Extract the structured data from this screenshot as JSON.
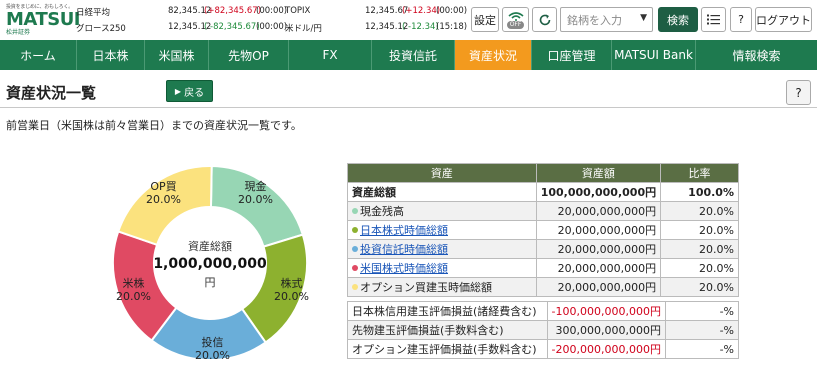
{
  "header": {
    "logo": {
      "tagline": "投資をまじめに、おもしろく。",
      "brand": "MATSUI",
      "sub": "松井証券"
    },
    "markets": [
      {
        "name": "日経平均",
        "value": "82,345.12",
        "change": "(+82,345.67)",
        "time": "(00:00)"
      },
      {
        "name": "グロース250",
        "value": "12,345.12",
        "change": "( -82,345.67)",
        "time": "(00:00)"
      },
      {
        "name": "TOPIX",
        "value": "12,345.67",
        "change": "(+12.34)",
        "time": "(00:00)"
      },
      {
        "name": "米ドル/円",
        "value": "12,345.12",
        "change": "( -12.34)",
        "time": "(15:18)"
      }
    ],
    "settings_label": "設定",
    "toggle_label": "OFF",
    "search_placeholder": "銘柄を入力",
    "search_button": "検索",
    "help": "?",
    "logout": "ログアウト"
  },
  "nav": [
    {
      "label": "ホーム"
    },
    {
      "label": "日本株"
    },
    {
      "label": "米国株"
    },
    {
      "label": "先物OP"
    },
    {
      "label": "FX"
    },
    {
      "label": "投資信託"
    },
    {
      "label": "資産状況"
    },
    {
      "label": "口座管理"
    },
    {
      "label": "MATSUI Bank"
    },
    {
      "label": "情報検索"
    }
  ],
  "page": {
    "title": "資産状況一覧",
    "back": "戻る",
    "help": "?",
    "lead": "前営業日（米国株は前々営業日）までの資産状況一覧です。"
  },
  "donut": {
    "center_label": "資産総額",
    "center_value": "1,000,000,000",
    "center_unit": "円",
    "segments": [
      {
        "name": "現金",
        "pct": "20.0%",
        "value": 20,
        "color": "#97d6b4"
      },
      {
        "name": "株式",
        "pct": "20.0%",
        "value": 20,
        "color": "#8db12f"
      },
      {
        "name": "投信",
        "pct": "20.0%",
        "value": 20,
        "color": "#6aaed9"
      },
      {
        "name": "米株",
        "pct": "20.0%",
        "value": 20,
        "color": "#e04a63"
      },
      {
        "name": "OP買",
        "pct": "20.0%",
        "value": 20,
        "color": "#fbe27e"
      }
    ]
  },
  "table": {
    "headers": [
      "資産",
      "資産額",
      "比率"
    ],
    "rows": [
      {
        "label": "資産総額",
        "amount": "100,000,000,000円",
        "ratio": "100.0%"
      },
      {
        "label": "現金残高",
        "amount": "20,000,000,000円",
        "ratio": "20.0%"
      },
      {
        "label": "日本株式時価総額",
        "amount": "20,000,000,000円",
        "ratio": "20.0%"
      },
      {
        "label": "投資信託時価総額",
        "amount": "20,000,000,000円",
        "ratio": "20.0%"
      },
      {
        "label": "米国株式時価総額",
        "amount": "20,000,000,000円",
        "ratio": "20.0%"
      },
      {
        "label": "オプション買建玉時価総額",
        "amount": "20,000,000,000円",
        "ratio": "20.0%"
      }
    ]
  },
  "table2": {
    "rows": [
      {
        "label": "日本株信用建玉評価損益(諸経費含む)",
        "amount": "-100,000,000,000円",
        "ratio": "-%"
      },
      {
        "label": "先物建玉評価損益(手数料含む)",
        "amount": "300,000,000,000円",
        "ratio": "-%"
      },
      {
        "label": "オプション建玉評価損益(手数料含む)",
        "amount": "-200,000,000,000円",
        "ratio": "-%"
      }
    ]
  }
}
